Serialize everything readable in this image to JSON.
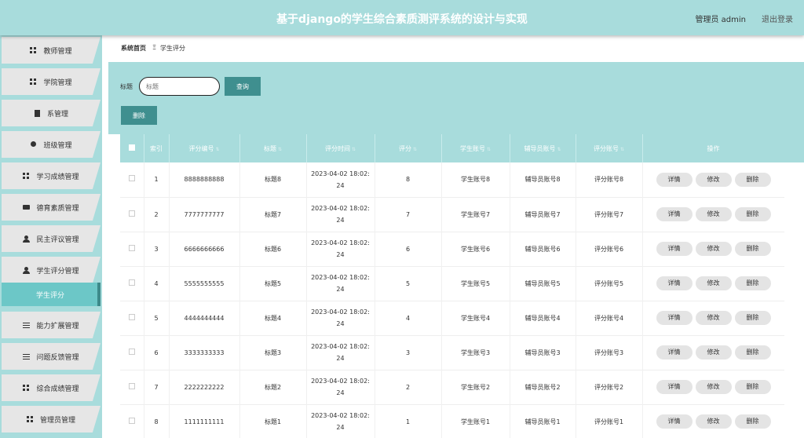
{
  "header": {
    "title": "基于django的学生综合素质测评系统的设计与实现",
    "user": "管理员 admin",
    "logout": "退出登录"
  },
  "sidebar": {
    "items": [
      {
        "label": "教师管理",
        "icon": "grid-icon"
      },
      {
        "label": "学院管理",
        "icon": "grid-icon"
      },
      {
        "label": "系管理",
        "icon": "clipboard-icon"
      },
      {
        "label": "班级管理",
        "icon": "bulb-icon"
      },
      {
        "label": "学习成绩管理",
        "icon": "grid-icon"
      },
      {
        "label": "德育素质管理",
        "icon": "chat-icon"
      },
      {
        "label": "民主评议管理",
        "icon": "person-icon"
      },
      {
        "label": "学生评分管理",
        "icon": "person-icon"
      },
      {
        "label": "能力扩展管理",
        "icon": "list-icon"
      },
      {
        "label": "问题反馈管理",
        "icon": "list-icon"
      },
      {
        "label": "综合成绩管理",
        "icon": "grid-icon"
      },
      {
        "label": "管理员管理",
        "icon": "grid-icon"
      }
    ],
    "active_sub": "学生评分"
  },
  "breadcrumb": {
    "home": "系统首页",
    "sep": "Ξ",
    "current": "学生评分"
  },
  "search": {
    "label": "标题",
    "placeholder": "标题",
    "query_btn": "查询",
    "delete_btn": "删除"
  },
  "table": {
    "headers": [
      "索引",
      "评分编号",
      "标题",
      "评分时间",
      "评分",
      "学生账号",
      "辅导员账号",
      "评分账号",
      "操作"
    ],
    "actions": [
      "详情",
      "修改",
      "删除"
    ],
    "rows": [
      {
        "idx": "1",
        "code": "8888888888",
        "title": "标题8",
        "time1": "2023-04-02 18:02:",
        "time2": "24",
        "score": "8",
        "student": "学生账号8",
        "counselor": "辅导员账号8",
        "rater": "评分账号8"
      },
      {
        "idx": "2",
        "code": "7777777777",
        "title": "标题7",
        "time1": "2023-04-02 18:02:",
        "time2": "24",
        "score": "7",
        "student": "学生账号7",
        "counselor": "辅导员账号7",
        "rater": "评分账号7"
      },
      {
        "idx": "3",
        "code": "6666666666",
        "title": "标题6",
        "time1": "2023-04-02 18:02:",
        "time2": "24",
        "score": "6",
        "student": "学生账号6",
        "counselor": "辅导员账号6",
        "rater": "评分账号6"
      },
      {
        "idx": "4",
        "code": "5555555555",
        "title": "标题5",
        "time1": "2023-04-02 18:02:",
        "time2": "24",
        "score": "5",
        "student": "学生账号5",
        "counselor": "辅导员账号5",
        "rater": "评分账号5"
      },
      {
        "idx": "5",
        "code": "4444444444",
        "title": "标题4",
        "time1": "2023-04-02 18:02:",
        "time2": "24",
        "score": "4",
        "student": "学生账号4",
        "counselor": "辅导员账号4",
        "rater": "评分账号4"
      },
      {
        "idx": "6",
        "code": "3333333333",
        "title": "标题3",
        "time1": "2023-04-02 18:02:",
        "time2": "24",
        "score": "3",
        "student": "学生账号3",
        "counselor": "辅导员账号3",
        "rater": "评分账号3"
      },
      {
        "idx": "7",
        "code": "2222222222",
        "title": "标题2",
        "time1": "2023-04-02 18:02:",
        "time2": "24",
        "score": "2",
        "student": "学生账号2",
        "counselor": "辅导员账号2",
        "rater": "评分账号2"
      },
      {
        "idx": "8",
        "code": "1111111111",
        "title": "标题1",
        "time1": "2023-04-02 18:02:",
        "time2": "24",
        "score": "1",
        "student": "学生账号1",
        "counselor": "辅导员账号1",
        "rater": "评分账号1"
      }
    ]
  }
}
